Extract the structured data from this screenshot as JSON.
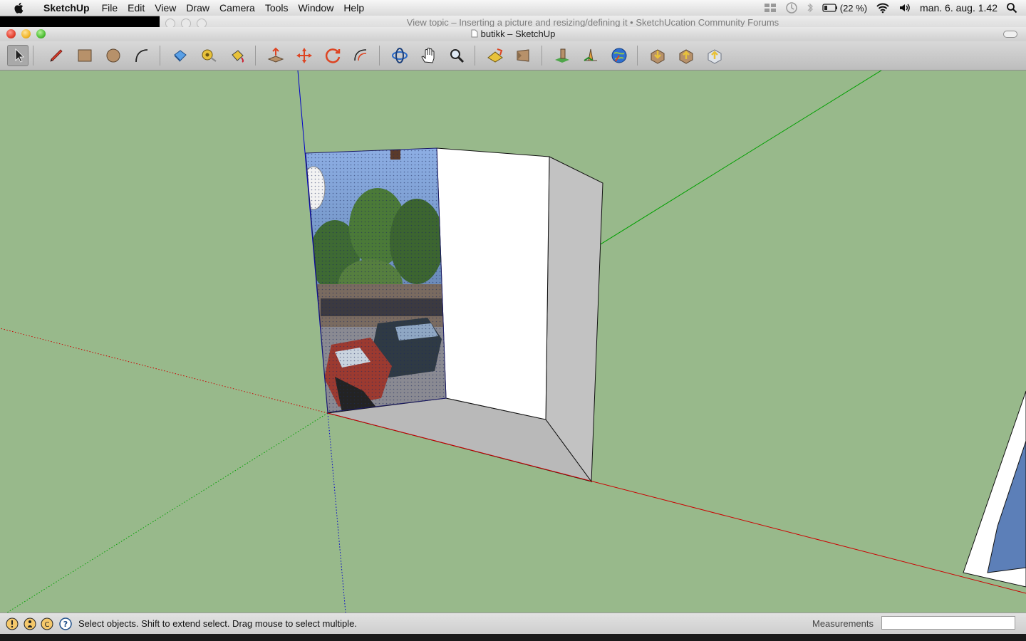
{
  "menubar": {
    "menus": [
      "SketchUp",
      "File",
      "Edit",
      "View",
      "Draw",
      "Camera",
      "Tools",
      "Window",
      "Help"
    ],
    "battery": "(22 %)",
    "clock": "man. 6. aug.  1.42"
  },
  "background_window": {
    "title": "View topic – Inserting a picture and resizing/defining it • SketchUcation Community Forums"
  },
  "window": {
    "title": "butikk – SketchUp"
  },
  "toolbar": {
    "tools": [
      "select-tool",
      "pencil-tool",
      "rectangle-tool",
      "circle-tool",
      "arc-tool",
      "eraser-tool",
      "tape-measure-tool",
      "paint-bucket-tool",
      "push-pull-tool",
      "move-tool",
      "rotate-tool",
      "offset-tool",
      "orbit-tool",
      "pan-tool",
      "zoom-tool",
      "zoom-extents-tool",
      "previous-view-tool",
      "add-location-tool",
      "toggle-terrain-tool",
      "google-earth-tool",
      "get-models-tool",
      "share-model-tool",
      "share-component-tool"
    ],
    "active_tool": "select-tool"
  },
  "viewport": {
    "background_color": "#98b98b",
    "axis_colors": {
      "red": "#cc0000",
      "green": "#00aa00",
      "blue": "#0000cc"
    }
  },
  "statusbar": {
    "message": "Select objects. Shift to extend select. Drag mouse to select multiple.",
    "measurements_label": "Measurements",
    "measurements_value": ""
  }
}
